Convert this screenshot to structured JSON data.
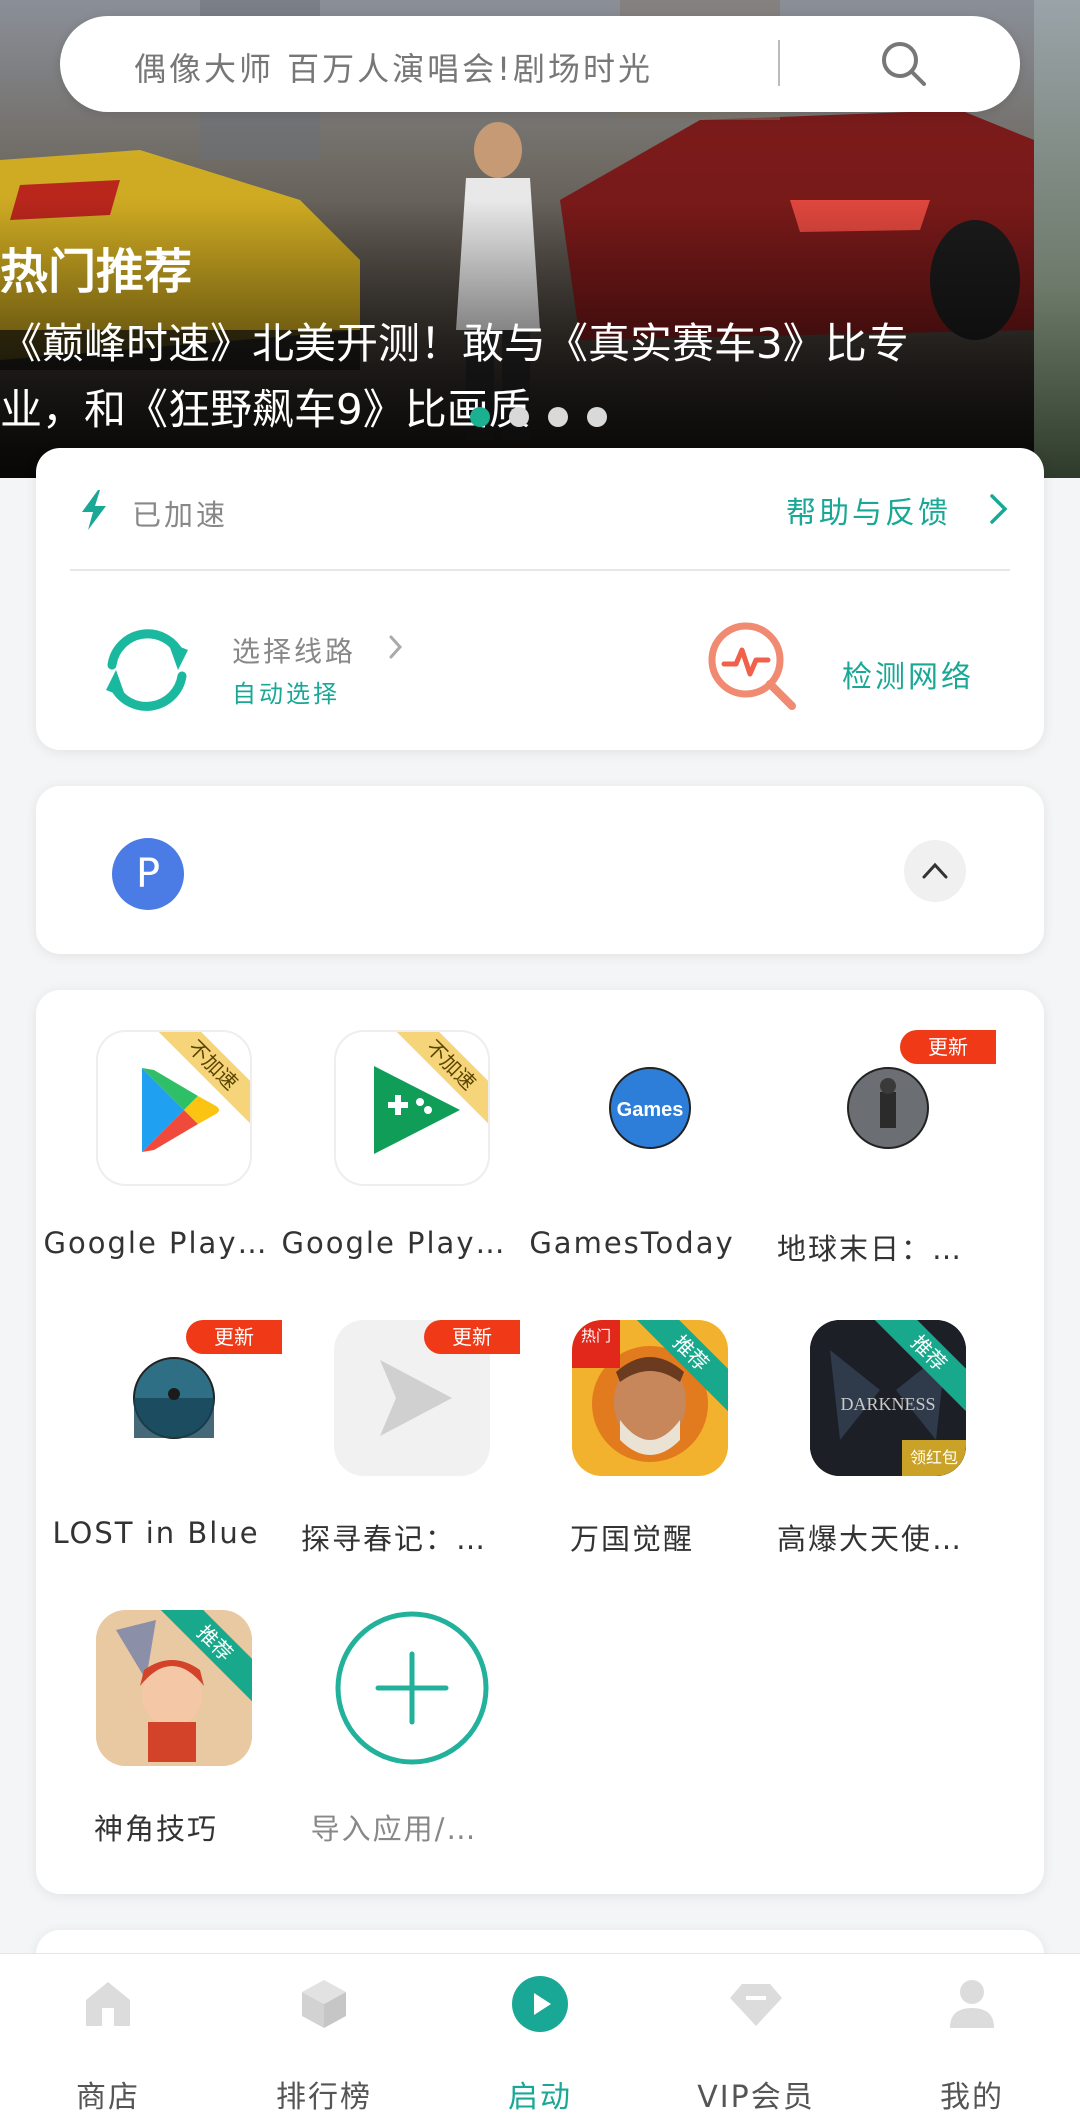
{
  "search": {
    "placeholder": "偶像大师 百万人演唱会!剧场时光"
  },
  "banner": {
    "title": "热门推荐",
    "line1": "《巅峰时速》北美开测！敢与《真实赛车3》比专",
    "line2": "业，和《狂野飙车9》比画质",
    "active_dot": 0,
    "dot_count": 4
  },
  "accelerator": {
    "status": "已加速",
    "help_link": "帮助与反馈",
    "route_label": "选择线路",
    "route_value": "自动选择",
    "network_check": "检测网络"
  },
  "profile": {
    "avatar_letter": "P"
  },
  "apps": [
    {
      "name": "Google Play…",
      "badge": "不加速",
      "badge_type": "ribbon-yellow",
      "icon": "google-play-store-icon"
    },
    {
      "name": "Google Play…",
      "badge": "不加速",
      "badge_type": "ribbon-yellow",
      "icon": "google-play-games-icon"
    },
    {
      "name": "GamesToday",
      "badge": "",
      "badge_type": "none",
      "icon": "gamestoday-icon"
    },
    {
      "name": "地球末日：…",
      "badge": "更新",
      "badge_type": "update",
      "icon": "last-day-on-earth-icon"
    },
    {
      "name": "LOST in Blue",
      "badge": "更新",
      "badge_type": "update",
      "icon": "lost-in-blue-icon"
    },
    {
      "name": "探寻春记：…",
      "badge": "更新",
      "badge_type": "update",
      "icon": "placeholder-play-icon"
    },
    {
      "name": "万国觉醒",
      "badge": "推荐",
      "badge_type": "ribbon-teal",
      "extra_badge": "热门",
      "icon": "rise-of-kingdoms-icon"
    },
    {
      "name": "高爆大天使…",
      "badge": "推荐",
      "badge_type": "ribbon-teal",
      "extra_badge": "领红包",
      "icon": "darkness-icon"
    },
    {
      "name": "神角技巧",
      "badge": "推荐",
      "badge_type": "ribbon-teal",
      "icon": "shenjiao-icon"
    },
    {
      "name": "导入应用/…",
      "badge": "",
      "badge_type": "none",
      "icon": "add-app-icon"
    }
  ],
  "nav": {
    "store": "商店",
    "ranking": "排行榜",
    "launch": "启动",
    "vip": "VIP会员",
    "mine": "我的"
  },
  "colors": {
    "accent": "#1aa896",
    "update_badge": "#f03a17",
    "recommend_ribbon": "#18a98c",
    "no_accel_ribbon": "#f5d47a"
  }
}
